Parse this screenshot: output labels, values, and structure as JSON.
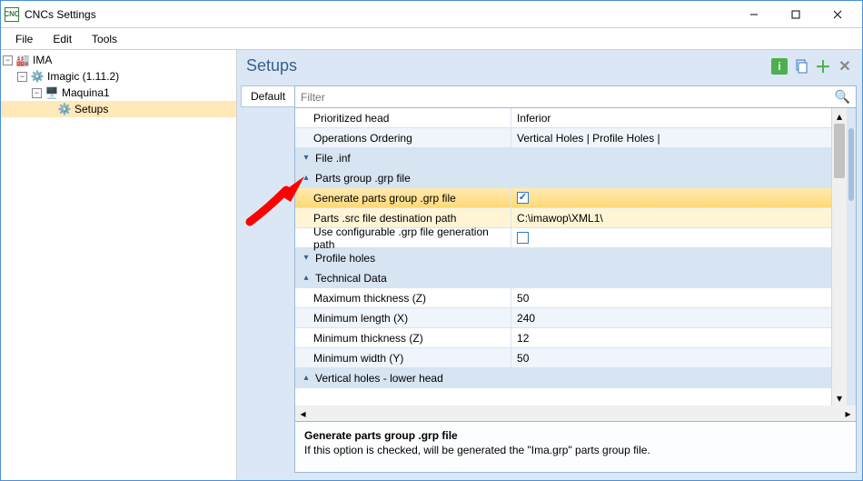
{
  "window": {
    "title": "CNCs Settings"
  },
  "menu": {
    "file": "File",
    "edit": "Edit",
    "tools": "Tools"
  },
  "tree": {
    "root": "IMA",
    "l1": "Imagic (1.11.2)",
    "l2": "Maquina1",
    "l3": "Setups"
  },
  "panel": {
    "title": "Setups"
  },
  "tab": {
    "default": "Default"
  },
  "filter": {
    "placeholder": "Filter"
  },
  "sections": {
    "file_inf": "File .inf",
    "parts_group": "Parts group .grp file",
    "profile_holes": "Profile holes",
    "technical_data": "Technical Data",
    "vertical_lower": "Vertical holes - lower head"
  },
  "rows": {
    "prioritized_head": {
      "label": "Prioritized head",
      "value": "Inferior"
    },
    "operations_ordering": {
      "label": "Operations Ordering",
      "value": "Vertical Holes | Profile Holes |"
    },
    "generate_grp": {
      "label": "Generate parts group .grp file"
    },
    "src_path": {
      "label": "Parts .src file destination path",
      "value": "C:\\imawop\\XML1\\"
    },
    "use_config_path": {
      "label": "Use configurable .grp file generation path"
    },
    "max_thick_z": {
      "label": "Maximum thickness (Z)",
      "value": "50"
    },
    "min_len_x": {
      "label": "Minimum length (X)",
      "value": "240"
    },
    "min_thick_z": {
      "label": "Minimum thickness (Z)",
      "value": "12"
    },
    "min_width_y": {
      "label": "Minimum width (Y)",
      "value": "50"
    }
  },
  "desc": {
    "title": "Generate parts group .grp file",
    "body": "If this option is checked, will be generated the \"Ima.grp\" parts group file."
  }
}
